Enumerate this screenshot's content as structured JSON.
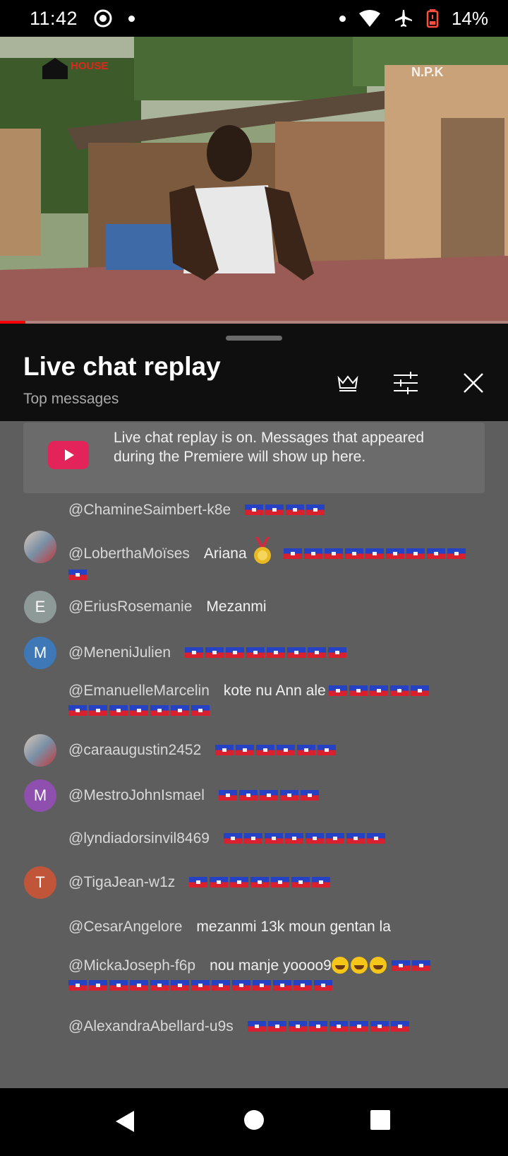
{
  "status_bar": {
    "time": "11:42",
    "battery_percent": "14%",
    "icons": [
      "screen-record-icon",
      "notification-dot-icon",
      "notification-dot-icon",
      "wifi-icon",
      "airplane-mode-icon",
      "battery-low-icon"
    ]
  },
  "video": {
    "channel_logo_text": "HOUSE",
    "watermark_text": "N.P.K",
    "progress": 0.05
  },
  "chat_panel": {
    "title": "Live chat replay",
    "subtitle": "Top messages",
    "buttons": [
      "crown-icon",
      "filter-settings-icon",
      "close-icon"
    ],
    "banner_text": "Live chat replay is on. Messages that appeared during the Premiere will show up here."
  },
  "messages": [
    {
      "author": "@ChamineSaimbert-k8e",
      "text": "",
      "flags": 4,
      "avatar": "none"
    },
    {
      "author": "@LoberthaMoïses",
      "text": "Ariana",
      "medal": true,
      "flags": 9,
      "flags_line2": 1,
      "avatar": "photo"
    },
    {
      "author": "@EriusRosemanie",
      "text": "Mezanmi",
      "flags": 0,
      "avatar_letter": "E",
      "avatar_color": "#8d9a98"
    },
    {
      "author": "@MeneniJulien",
      "text": "",
      "flags": 8,
      "avatar_letter": "M",
      "avatar_color": "#3f78b7"
    },
    {
      "author": "@EmanuelleMarcelin",
      "text": "kote nu Ann ale",
      "flags": 5,
      "flags_line2": 7,
      "avatar": "none"
    },
    {
      "author": "@caraaugustin2452",
      "text": "",
      "flags": 6,
      "avatar": "photo"
    },
    {
      "author": "@MestroJohnIsmael",
      "text": "",
      "flags": 5,
      "avatar_letter": "M",
      "avatar_color": "#8e4fae"
    },
    {
      "author": "@lyndiadorsinvil8469",
      "text": "",
      "flags": 8,
      "avatar": "none"
    },
    {
      "author": "@TigaJean-w1z",
      "text": "",
      "flags": 7,
      "avatar_letter": "T",
      "avatar_color": "#c1553a"
    },
    {
      "author": "@CesarAngelore",
      "text": "mezanmi 13k moun gentan la",
      "flags": 0,
      "avatar": "none"
    },
    {
      "author": "@MickaJoseph-f6p",
      "text": "nou manje yoooo9",
      "emojis": 3,
      "flags": 2,
      "flags_line2": 13,
      "avatar": "none"
    },
    {
      "author": "@AlexandraAbellard-u9s",
      "text": "",
      "flags": 8,
      "avatar": "none"
    }
  ],
  "nav_bar": {
    "buttons": [
      "back-icon",
      "home-icon",
      "recents-icon"
    ]
  },
  "colors": {
    "panel_bg": "#5e5e5e",
    "header_bg": "#0f0f0f",
    "accent_red": "#ff0000",
    "play_icon_bg": "#e3245a"
  }
}
